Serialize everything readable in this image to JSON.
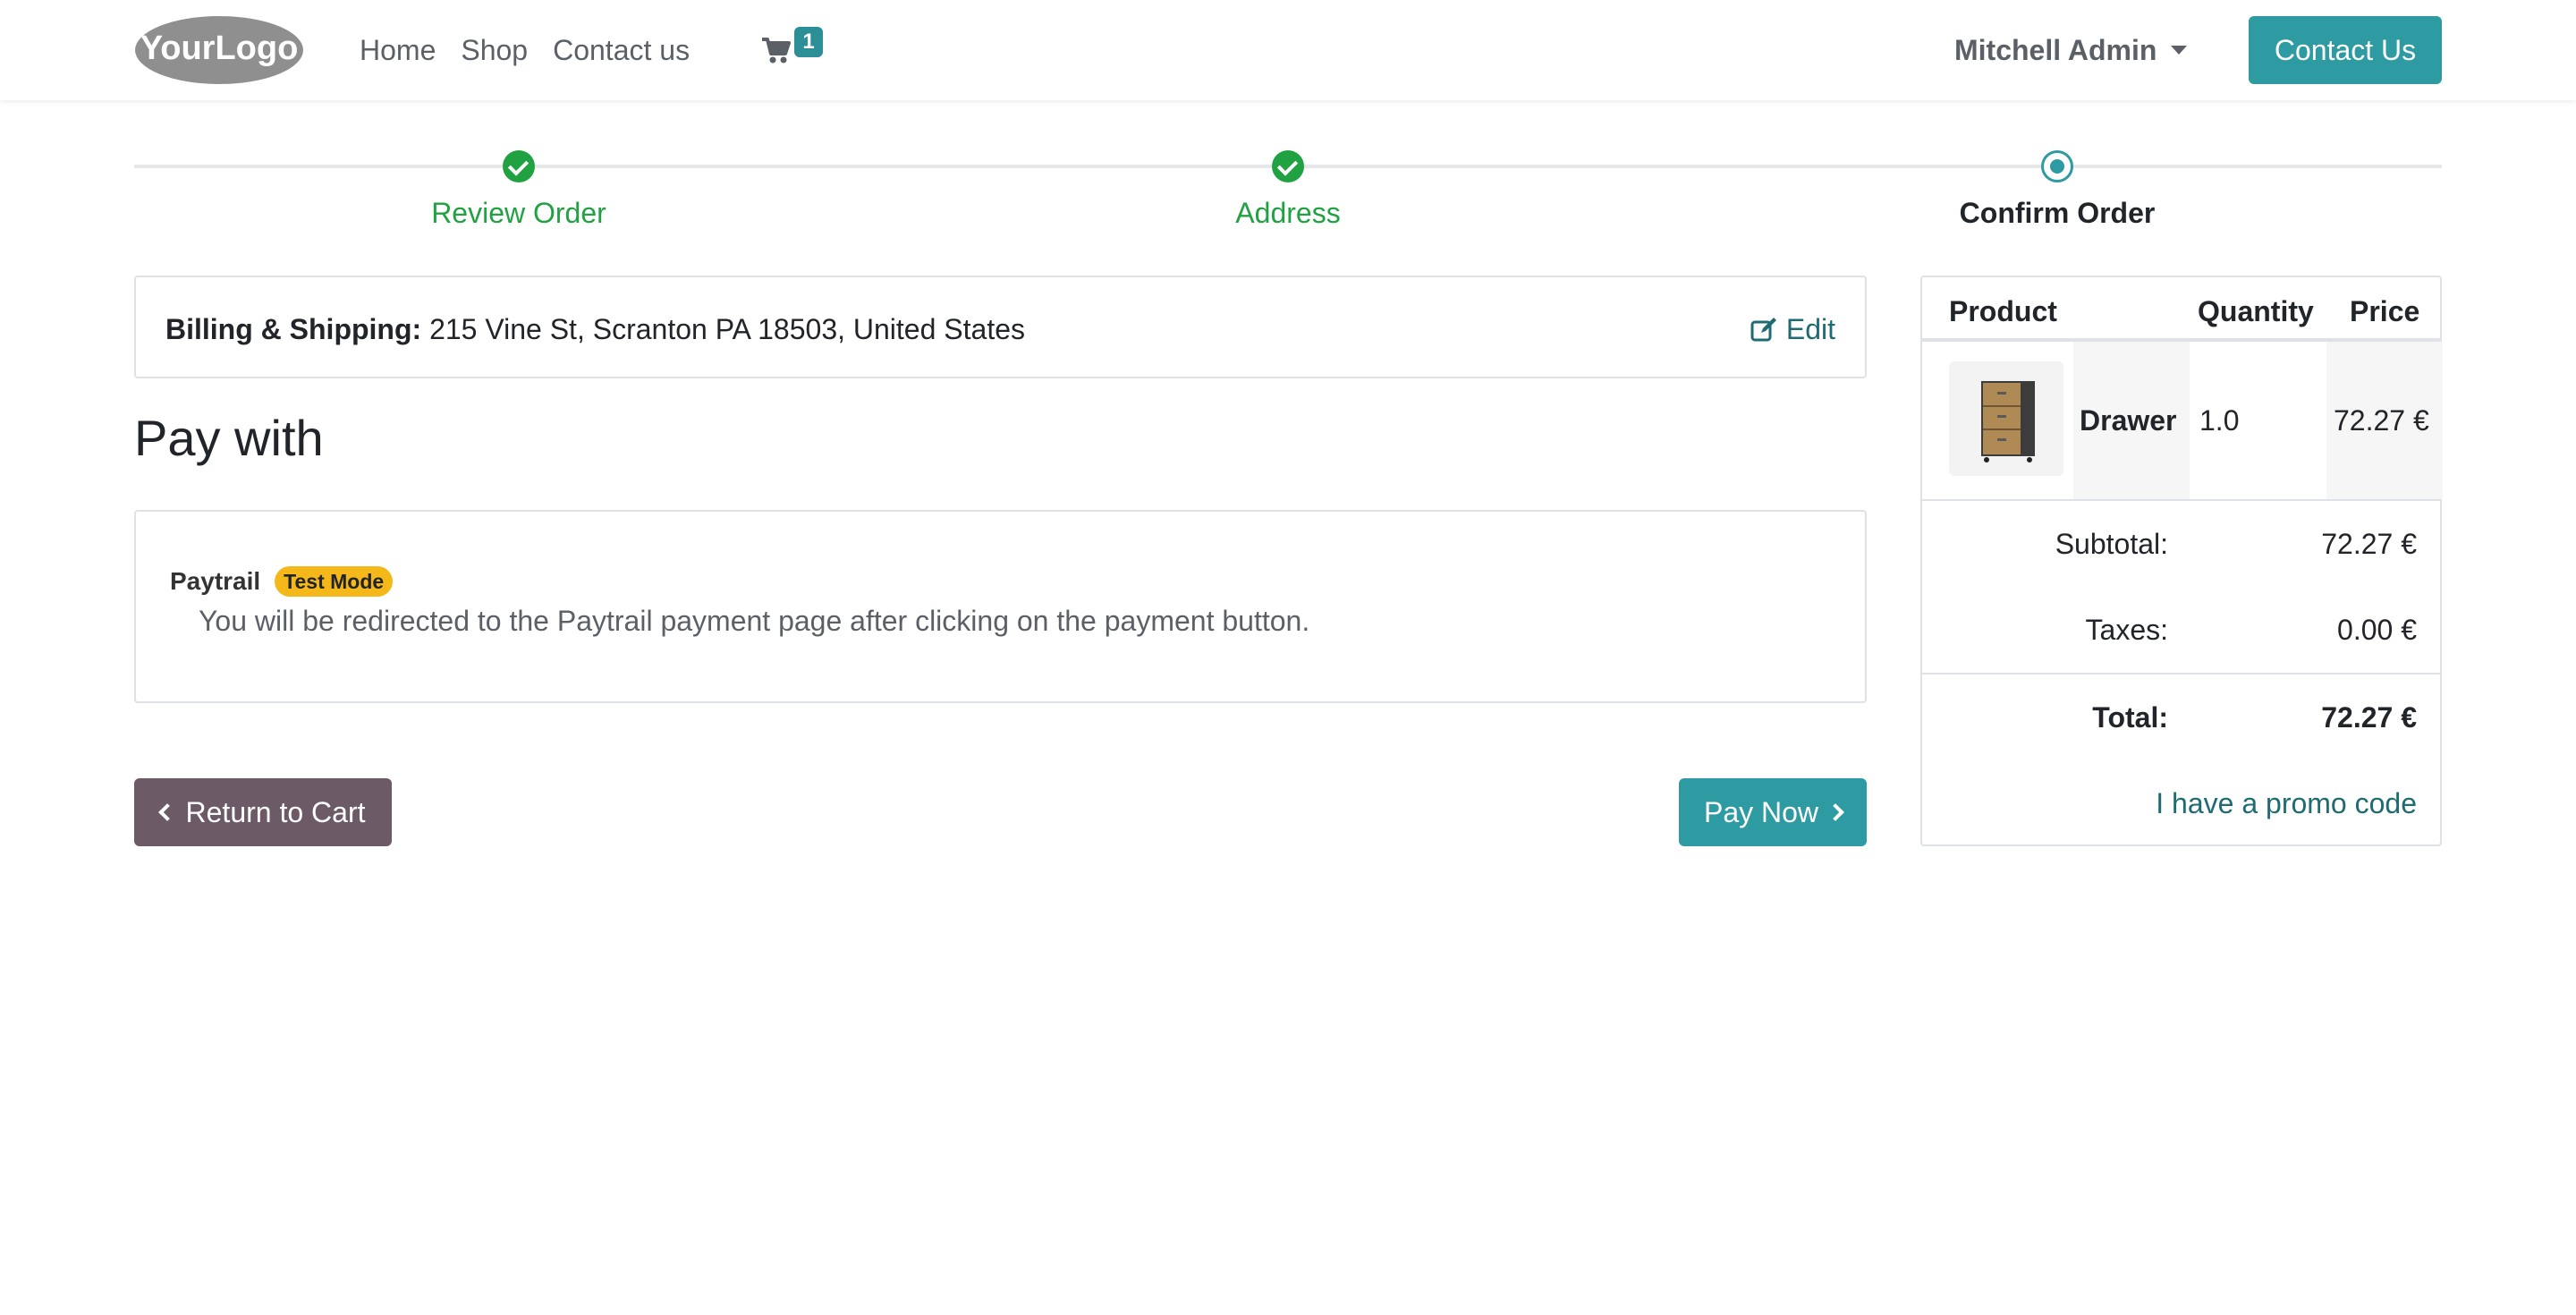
{
  "header": {
    "logo_text": "YourLogo",
    "nav": [
      "Home",
      "Shop",
      "Contact us"
    ],
    "cart_count": "1",
    "user_name": "Mitchell Admin",
    "contact_button": "Contact Us"
  },
  "steps": [
    {
      "label": "Review Order",
      "state": "done"
    },
    {
      "label": "Address",
      "state": "done"
    },
    {
      "label": "Confirm Order",
      "state": "current"
    }
  ],
  "billing": {
    "label": "Billing & Shipping:",
    "address": "215 Vine St, Scranton PA 18503, United States",
    "edit_label": "Edit"
  },
  "pay_with_title": "Pay with",
  "payment": {
    "provider": "Paytrail",
    "badge": "Test Mode",
    "description": "You will be redirected to the Paytrail payment page after clicking on the payment button."
  },
  "actions": {
    "return_label": "Return to Cart",
    "pay_now_label": "Pay Now"
  },
  "summary": {
    "headers": {
      "product": "Product",
      "quantity": "Quantity",
      "price": "Price"
    },
    "items": [
      {
        "name": "Drawer",
        "quantity": "1.0",
        "price": "72.27 €"
      }
    ],
    "subtotal_label": "Subtotal:",
    "subtotal": "72.27 €",
    "taxes_label": "Taxes:",
    "taxes": "0.00 €",
    "total_label": "Total:",
    "total": "72.27 €",
    "promo_label": "I have a promo code"
  },
  "colors": {
    "primary": "#2e9aa2",
    "success": "#21a242",
    "secondary": "#6d5a67",
    "warning": "#f5b81a",
    "link": "#1f6b73"
  }
}
